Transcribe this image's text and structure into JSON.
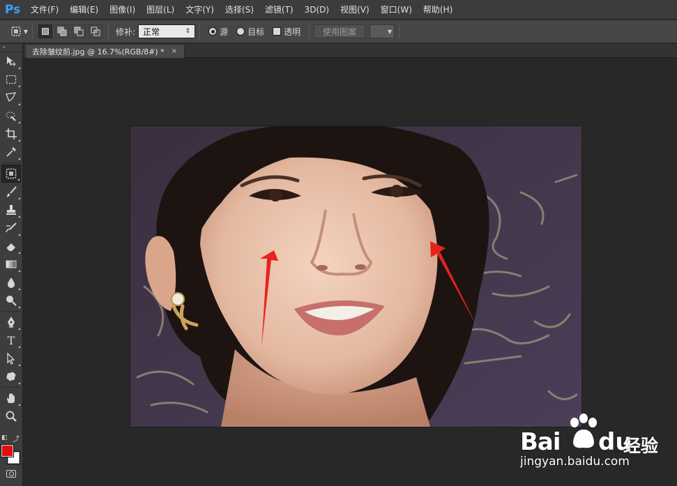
{
  "app": {
    "logo": "Ps"
  },
  "menu": [
    {
      "label": "文件(F)"
    },
    {
      "label": "编辑(E)"
    },
    {
      "label": "图像(I)"
    },
    {
      "label": "图层(L)"
    },
    {
      "label": "文字(Y)"
    },
    {
      "label": "选择(S)"
    },
    {
      "label": "滤镜(T)"
    },
    {
      "label": "3D(D)"
    },
    {
      "label": "视图(V)"
    },
    {
      "label": "窗口(W)"
    },
    {
      "label": "帮助(H)"
    }
  ],
  "options": {
    "repair_label": "修补:",
    "repair_mode": "正常",
    "source_label": "源",
    "target_label": "目标",
    "transparent_label": "透明",
    "use_pattern_label": "使用图案",
    "source_selected": true,
    "transparent_checked": false
  },
  "document": {
    "tab_title": "去除皱纹前.jpg @ 16.7%(RGB/8#) *",
    "close_glyph": "×"
  },
  "tools": [
    {
      "name": "move-tool",
      "icon": "move-icon"
    },
    {
      "name": "marquee-tool",
      "icon": "rect-marquee-icon"
    },
    {
      "name": "lasso-tool",
      "icon": "polygon-lasso-icon"
    },
    {
      "name": "quick-select-tool",
      "icon": "quick-select-icon"
    },
    {
      "name": "crop-tool",
      "icon": "crop-icon"
    },
    {
      "name": "eyedropper-tool",
      "icon": "eyedropper-icon"
    },
    {
      "name": "patch-tool",
      "icon": "patch-icon",
      "active": true
    },
    {
      "name": "brush-tool",
      "icon": "brush-icon"
    },
    {
      "name": "stamp-tool",
      "icon": "stamp-icon"
    },
    {
      "name": "history-brush-tool",
      "icon": "history-brush-icon"
    },
    {
      "name": "eraser-tool",
      "icon": "eraser-icon"
    },
    {
      "name": "gradient-tool",
      "icon": "gradient-icon"
    },
    {
      "name": "blur-tool",
      "icon": "blur-drop-icon"
    },
    {
      "name": "dodge-tool",
      "icon": "dodge-icon"
    },
    {
      "name": "pen-tool",
      "icon": "pen-icon"
    },
    {
      "name": "type-tool",
      "icon": "type-icon",
      "glyph": "T"
    },
    {
      "name": "path-select-tool",
      "icon": "path-select-icon"
    },
    {
      "name": "shape-tool",
      "icon": "custom-shape-icon"
    },
    {
      "name": "hand-tool",
      "icon": "hand-icon"
    },
    {
      "name": "zoom-tool",
      "icon": "zoom-icon"
    }
  ],
  "colors": {
    "foreground": "#e01010",
    "background": "#ffffff",
    "ui_menu_bg": "#3c3c3c",
    "ui_canvas_bg": "#282828",
    "arrow_red": "#e8231f"
  },
  "watermark": {
    "brand_left": "Bai",
    "brand_right": "du",
    "jingyan": "经验",
    "url": "jingyan.baidu.com"
  }
}
